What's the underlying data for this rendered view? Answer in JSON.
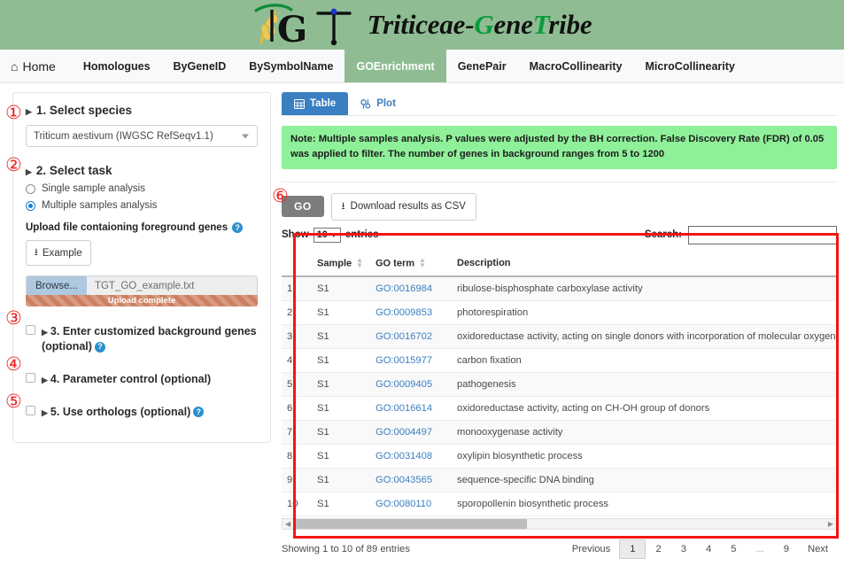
{
  "banner": {
    "logo_letters": [
      "T",
      "G",
      "T"
    ],
    "brand_part1": "Triticeae-",
    "brand_g": "G",
    "brand_part2": "ene",
    "brand_t": "T",
    "brand_part3": "ribe",
    "bg_color": "#8fbc92",
    "green_accent": "#0a9b3c",
    "wheat_color": "#e8b93c"
  },
  "nav": {
    "home_icon": "home-icon",
    "items": [
      {
        "label": "Home",
        "active": false,
        "icon": "home-icon"
      },
      {
        "label": "Homologues",
        "active": false
      },
      {
        "label": "ByGeneID",
        "active": false
      },
      {
        "label": "BySymbolName",
        "active": false
      },
      {
        "label": "GOEnrichment",
        "active": true
      },
      {
        "label": "GenePair",
        "active": false
      },
      {
        "label": "MacroCollinearity",
        "active": false
      },
      {
        "label": "MicroCollinearity",
        "active": false
      }
    ],
    "active_bg": "#8fbc92"
  },
  "sidebar": {
    "step1": {
      "title": "1. Select species",
      "select_value": "Triticum aestivum (IWGSC RefSeqv1.1)"
    },
    "step2": {
      "title": "2. Select task",
      "radios": [
        {
          "label": "Single sample analysis",
          "checked": false
        },
        {
          "label": "Multiple samples analysis",
          "checked": true
        }
      ],
      "upload_label": "Upload file contaioning foreground genes",
      "help_icon": "question-mark-icon",
      "example_button": "Example",
      "example_icon": "download-icon",
      "browse_button": "Browse...",
      "file_name": "TGT_GO_example.txt",
      "progress_text": "Upload complete",
      "progress_color": "#cd7f5f",
      "browse_color": "#aec8df"
    },
    "step3": {
      "title": "3. Enter customized background genes (optional)",
      "checked": false,
      "help": true
    },
    "step4": {
      "title": "4. Parameter control (optional)",
      "checked": false,
      "help": false
    },
    "step5": {
      "title": "5. Use orthologs (optional)",
      "checked": false,
      "help": true
    }
  },
  "main": {
    "tabs": [
      {
        "label": "Table",
        "active": true,
        "icon": "table-icon"
      },
      {
        "label": "Plot",
        "active": false,
        "icon": "sliders-icon"
      }
    ],
    "note": "Note: Multiple samples analysis. P values were adjusted by the BH correction. False Discovery Rate (FDR) of 0.05 was applied to filter. The number of genes in background ranges from 5 to 1200",
    "note_bg": "#8ff09a",
    "go_button": "GO",
    "csv_button": "Download results as CSV",
    "csv_icon": "download-icon",
    "show_label": "Show",
    "entries_label": "entries",
    "entries_value": "10",
    "search_label": "Search:",
    "search_value": "",
    "table": {
      "columns": [
        "",
        "Sample",
        "GO term",
        "Description"
      ],
      "sortable": [
        false,
        true,
        true,
        false
      ],
      "rows": [
        {
          "idx": "1",
          "sample": "S1",
          "go": "GO:0016984",
          "desc": "ribulose-bisphosphate carboxylase activity"
        },
        {
          "idx": "2",
          "sample": "S1",
          "go": "GO:0009853",
          "desc": "photorespiration"
        },
        {
          "idx": "3",
          "sample": "S1",
          "go": "GO:0016702",
          "desc": "oxidoreductase activity, acting on single donors with incorporation of molecular oxygen, incorpora"
        },
        {
          "idx": "4",
          "sample": "S1",
          "go": "GO:0015977",
          "desc": "carbon fixation"
        },
        {
          "idx": "5",
          "sample": "S1",
          "go": "GO:0009405",
          "desc": "pathogenesis"
        },
        {
          "idx": "6",
          "sample": "S1",
          "go": "GO:0016614",
          "desc": "oxidoreductase activity, acting on CH-OH group of donors"
        },
        {
          "idx": "7",
          "sample": "S1",
          "go": "GO:0004497",
          "desc": "monooxygenase activity"
        },
        {
          "idx": "8",
          "sample": "S1",
          "go": "GO:0031408",
          "desc": "oxylipin biosynthetic process"
        },
        {
          "idx": "9",
          "sample": "S1",
          "go": "GO:0043565",
          "desc": "sequence-specific DNA binding"
        },
        {
          "idx": "10",
          "sample": "S1",
          "go": "GO:0080110",
          "desc": "sporopollenin biosynthetic process"
        }
      ]
    },
    "showing": "Showing 1 to 10 of 89 entries",
    "pager": {
      "previous": "Previous",
      "pages": [
        "1",
        "2",
        "3",
        "4",
        "5",
        "...",
        "9"
      ],
      "current": "1",
      "next": "Next"
    }
  },
  "annotations": {
    "markers": [
      "①",
      "②",
      "③",
      "④",
      "⑤",
      "⑥"
    ],
    "color": "#ef2121",
    "box_color": "#f41414"
  }
}
